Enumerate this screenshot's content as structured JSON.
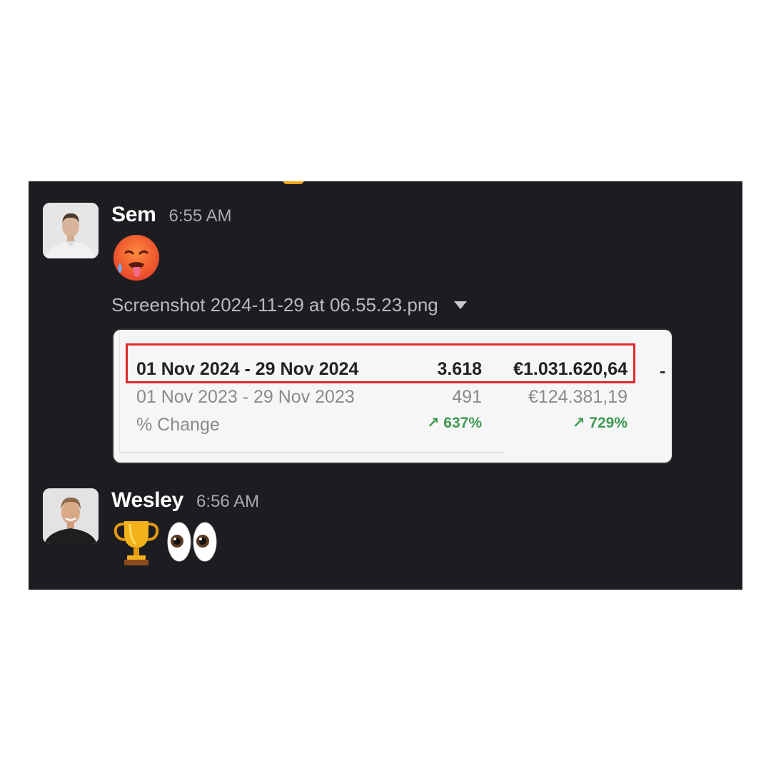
{
  "messages": [
    {
      "author": "Sem",
      "time": "6:55 AM",
      "emoji": "hot-face-sweat-icon",
      "attachment": {
        "file_name": "Screenshot 2024-11-29 at 06.55.23.png",
        "table": {
          "rows": [
            {
              "period": "01 Nov 2024 - 29 Nov 2024",
              "count": "3.618",
              "amount": "€1.031.620,64",
              "highlighted": true
            },
            {
              "period": "01 Nov 2023 - 29 Nov 2023",
              "count": "491",
              "amount": "€124.381,19",
              "highlighted": false
            },
            {
              "period": "% Change",
              "count": "↗ 637%",
              "amount": "↗ 729%",
              "highlighted": false
            }
          ],
          "cutoff_text": "-"
        }
      }
    },
    {
      "author": "Wesley",
      "time": "6:56 AM",
      "emojis": [
        "trophy-icon",
        "eyes-icon"
      ]
    }
  ],
  "colors": {
    "panel_bg": "#1c1d21",
    "highlight": "#e0282a",
    "positive": "#3e9a52"
  }
}
